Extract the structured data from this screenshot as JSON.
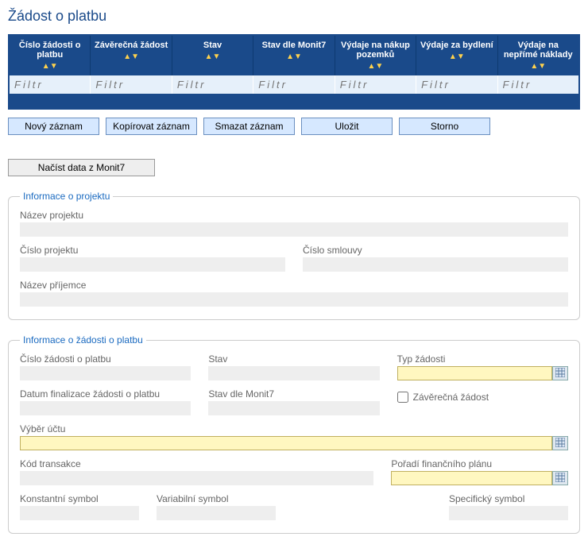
{
  "page_title": "Žádost o platbu",
  "grid_columns": [
    "Číslo žádosti o platbu",
    "Závěrečná žádost",
    "Stav",
    "Stav dle Monit7",
    "Výdaje na nákup pozemků",
    "Výdaje za bydlení",
    "Výdaje na nepřímé náklady"
  ],
  "filter_placeholder": "Filtr",
  "buttons": {
    "new": "Nový záznam",
    "copy": "Kopírovat záznam",
    "delete": "Smazat záznam",
    "save": "Uložit",
    "cancel": "Storno",
    "load": "Načíst data z Monit7"
  },
  "fs1": {
    "legend": "Informace o projektu",
    "project_name_label": "Název projektu",
    "project_number_label": "Číslo projektu",
    "contract_number_label": "Číslo smlouvy",
    "recipient_name_label": "Název příjemce",
    "project_name": "",
    "project_number": "",
    "contract_number": "",
    "recipient_name": ""
  },
  "fs2": {
    "legend": "Informace o žádosti o platbu",
    "request_number_label": "Číslo žádosti o platbu",
    "status_label": "Stav",
    "request_type_label": "Typ žádosti",
    "finalize_date_label": "Datum finalizace žádosti o platbu",
    "status_monit_label": "Stav dle Monit7",
    "final_request_label": "Závěrečná žádost",
    "account_select_label": "Výběr účtu",
    "transaction_code_label": "Kód transakce",
    "finplan_order_label": "Pořadí finančního plánu",
    "const_symbol_label": "Konstantní symbol",
    "var_symbol_label": "Variabilní symbol",
    "spec_symbol_label": "Specifický symbol",
    "request_number": "",
    "status": "",
    "request_type": "",
    "finalize_date": "",
    "status_monit": "",
    "final_request": false,
    "account_select": "",
    "transaction_code": "",
    "finplan_order": "",
    "const_symbol": "",
    "var_symbol": "",
    "spec_symbol": ""
  }
}
